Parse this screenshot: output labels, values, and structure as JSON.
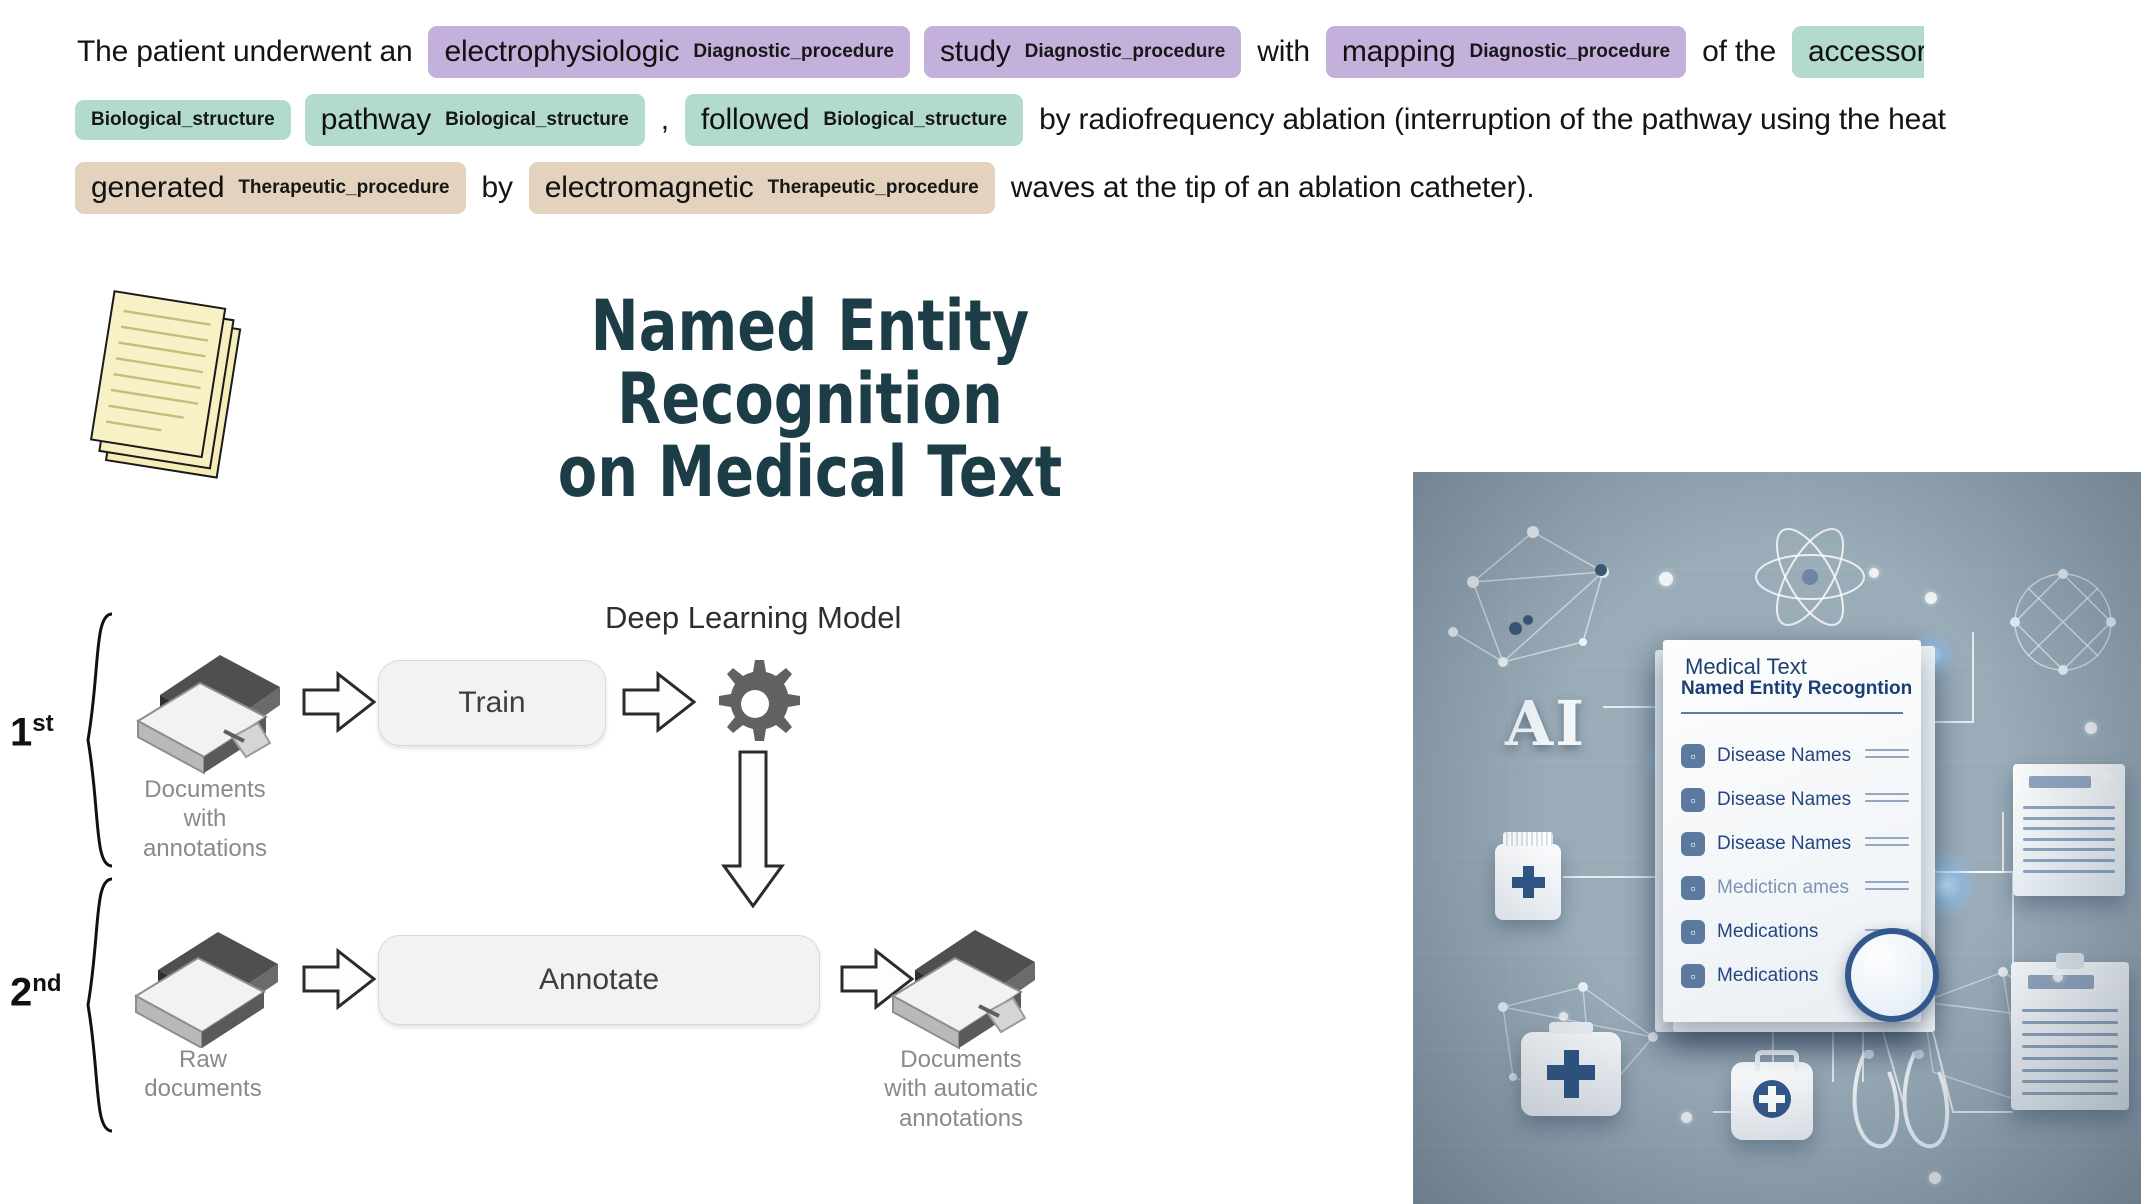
{
  "ner_text": {
    "lines": [
      [
        {
          "kind": "plain",
          "text": "The patient underwent an"
        },
        {
          "kind": "tag",
          "type": "Diagnostic_procedure",
          "token": "electrophysiologic",
          "label": "Diagnostic_procedure"
        },
        {
          "kind": "tag",
          "type": "Diagnostic_procedure",
          "token": "study",
          "label": "Diagnostic_procedure"
        },
        {
          "kind": "plain",
          "text": "with"
        },
        {
          "kind": "tag",
          "type": "Diagnostic_procedure",
          "token": "mapping",
          "label": "Diagnostic_procedure"
        },
        {
          "kind": "plain",
          "text": "of the"
        },
        {
          "kind": "tag",
          "type": "Biological_structure",
          "token": "accessory",
          "label": "",
          "clipped": true
        }
      ],
      [
        {
          "kind": "tag",
          "type": "Biological_structure",
          "token": "",
          "label": "Biological_structure"
        },
        {
          "kind": "tag",
          "type": "Biological_structure",
          "token": "pathway",
          "label": "Biological_structure"
        },
        {
          "kind": "plain",
          "text": ","
        },
        {
          "kind": "tag",
          "type": "Biological_structure",
          "token": "followed",
          "label": "Biological_structure"
        },
        {
          "kind": "plain",
          "text": "by radiofrequency ablation (interruption of the pathway using the heat"
        }
      ],
      [
        {
          "kind": "tag",
          "type": "Therapeutic_procedure",
          "token": "generated",
          "label": "Therapeutic_procedure"
        },
        {
          "kind": "plain",
          "text": "by"
        },
        {
          "kind": "tag",
          "type": "Therapeutic_procedure",
          "token": "electromagnetic",
          "label": "Therapeutic_procedure"
        },
        {
          "kind": "plain",
          "text": "waves at the tip of an ablation catheter)."
        }
      ]
    ],
    "entity_colors": {
      "Diagnostic_procedure": "#c3b0db",
      "Biological_structure": "#b2dbcd",
      "Therapeutic_procedure": "#e3d2bd"
    }
  },
  "title": {
    "line1": "Named Entity Recognition",
    "line2": "on Medical Text",
    "color": "#1d3d46",
    "icon": "stacked-documents-icon"
  },
  "diagram": {
    "stage1": {
      "ordinal": "1",
      "ordinal_suffix": "st",
      "source_caption": "Documents\nwith\nannotations",
      "source_caption_lines": [
        "Documents",
        "with",
        "annotations"
      ],
      "action": "Train"
    },
    "stage2": {
      "ordinal": "2",
      "ordinal_suffix": "nd",
      "source_caption_lines": [
        "Raw",
        "documents"
      ],
      "action": "Annotate",
      "output_caption_lines": [
        "Documents",
        "with automatic",
        "annotations"
      ]
    },
    "model_label": "Deep Learning Model",
    "model_icon": "gear-icon"
  },
  "ai_image": {
    "ai_label": "AI",
    "card": {
      "title_line1": "Medical Text",
      "title_line2": "Named Entity Recogntion",
      "rows": [
        {
          "label": "Disease Names",
          "faded": false
        },
        {
          "label": "Disease Names",
          "faded": false
        },
        {
          "label": "Disease Names",
          "faded": false
        },
        {
          "label": "Medicticn  ames",
          "faded": true
        },
        {
          "label": "Medications",
          "faded": false
        },
        {
          "label": "Medications",
          "faded": false
        }
      ]
    },
    "objects": [
      "pill-bottle-icon",
      "first-aid-box-icon",
      "medical-kit-icon",
      "stethoscope-icon",
      "magnifier-icon",
      "document-sheet-icon",
      "clipboard-icon",
      "atom-icon",
      "molecule-network-icon"
    ],
    "background_color": "#9aacb8",
    "accent_color": "#23477e"
  }
}
